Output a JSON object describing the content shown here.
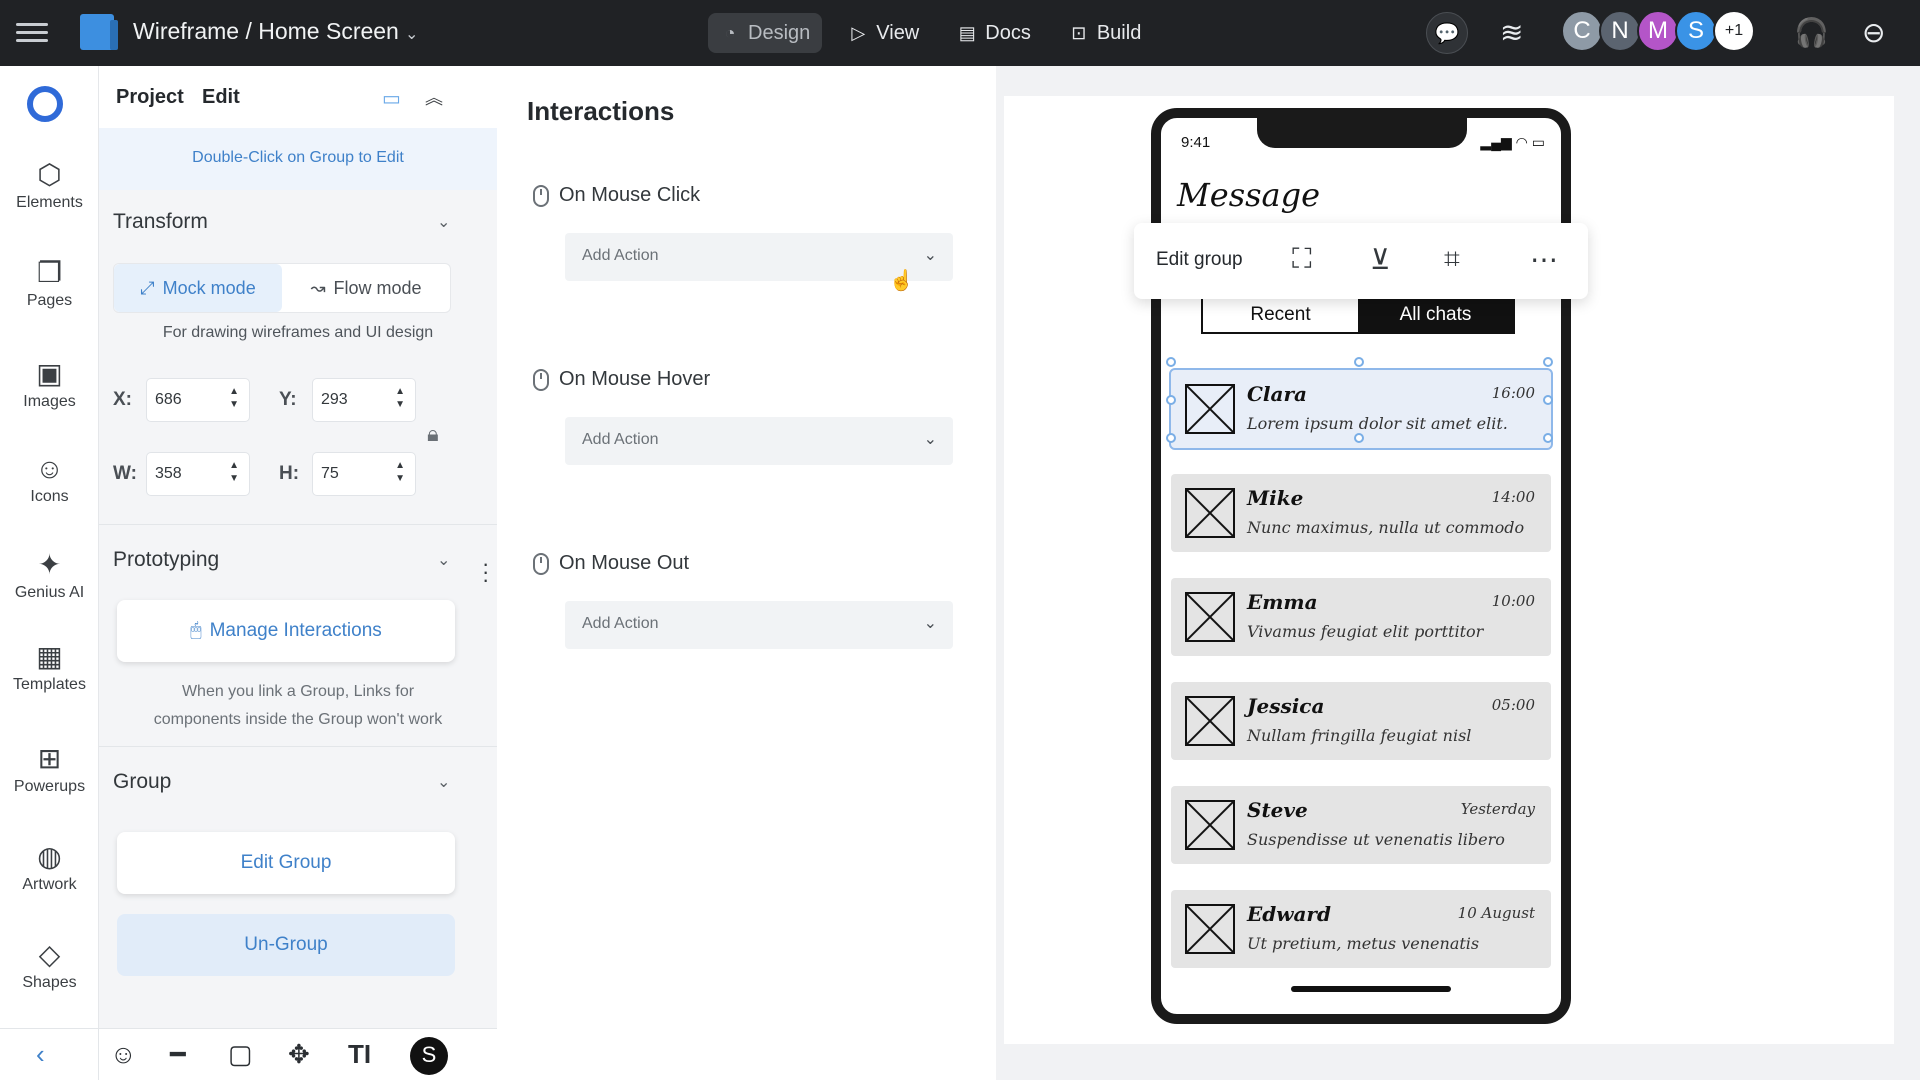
{
  "topbar": {
    "title": "Wireframe / Home Screen",
    "caret": "⌄",
    "modes": [
      {
        "label": "Design",
        "icon": "design-icon",
        "active": true
      },
      {
        "label": "View",
        "icon": "play-icon",
        "active": false
      },
      {
        "label": "Docs",
        "icon": "document-icon",
        "active": false
      },
      {
        "label": "Build",
        "icon": "build-icon",
        "active": false
      }
    ],
    "avatars": [
      {
        "initial": "C",
        "color": "#8e9aa6"
      },
      {
        "initial": "N",
        "color": "#5b6470"
      },
      {
        "initial": "M",
        "color": "#b455c8"
      },
      {
        "initial": "S",
        "color": "#3a93e6"
      }
    ],
    "more_users": "+1"
  },
  "rail": {
    "items": [
      {
        "label": "Elements",
        "icon": "cube-icon"
      },
      {
        "label": "Pages",
        "icon": "pages-icon"
      },
      {
        "label": "Images",
        "icon": "image-icon"
      },
      {
        "label": "Icons",
        "icon": "smiley-icon"
      },
      {
        "label": "Genius AI",
        "icon": "sparkle-icon"
      },
      {
        "label": "Templates",
        "icon": "templates-icon"
      },
      {
        "label": "Powerups",
        "icon": "powerups-icon"
      },
      {
        "label": "Artwork",
        "icon": "artwork-icon"
      },
      {
        "label": "Shapes",
        "icon": "diamond-icon"
      }
    ]
  },
  "props": {
    "tab_project": "Project",
    "tab_edit": "Edit",
    "hint": "Double-Click on Group to Edit",
    "transform": {
      "title": "Transform",
      "mock_mode": "Mock mode",
      "flow_mode": "Flow mode",
      "mode_desc": "For drawing wireframes and UI design",
      "x_label": "X:",
      "x": "686",
      "y_label": "Y:",
      "y": "293",
      "w_label": "W:",
      "w": "358",
      "h_label": "H:",
      "h": "75"
    },
    "prototyping": {
      "title": "Prototyping",
      "manage": "Manage Interactions",
      "note_line1": "When you link a Group, Links for",
      "note_line2": "components inside the Group won't work"
    },
    "group": {
      "title": "Group",
      "edit": "Edit Group",
      "ungroup": "Un-Group"
    }
  },
  "interactions": {
    "title": "Interactions",
    "events": [
      {
        "label": "On Mouse Click",
        "action": "Add Action"
      },
      {
        "label": "On Mouse Hover",
        "action": "Add Action"
      },
      {
        "label": "On Mouse Out",
        "action": "Add Action"
      }
    ]
  },
  "mockup": {
    "time": "9:41",
    "title": "Message",
    "toolbar_label": "Edit group",
    "tab_recent": "Recent",
    "tab_all": "All chats",
    "chats": [
      {
        "name": "Clara",
        "time": "16:00",
        "text": "Lorem ipsum dolor sit amet elit."
      },
      {
        "name": "Mike",
        "time": "14:00",
        "text": "Nunc maximus, nulla ut commodo"
      },
      {
        "name": "Emma",
        "time": "10:00",
        "text": "Vivamus feugiat elit porttitor"
      },
      {
        "name": "Jessica",
        "time": "05:00",
        "text": "Nullam fringilla feugiat nisl"
      },
      {
        "name": "Steve",
        "time": "Yesterday",
        "text": "Suspendisse ut venenatis libero"
      },
      {
        "name": "Edward",
        "time": "10 August",
        "text": "Ut pretium, metus venenatis"
      }
    ]
  },
  "colors": {
    "accent": "#3f81c9",
    "topbar": "#202225",
    "selection": "#7aaee6"
  }
}
